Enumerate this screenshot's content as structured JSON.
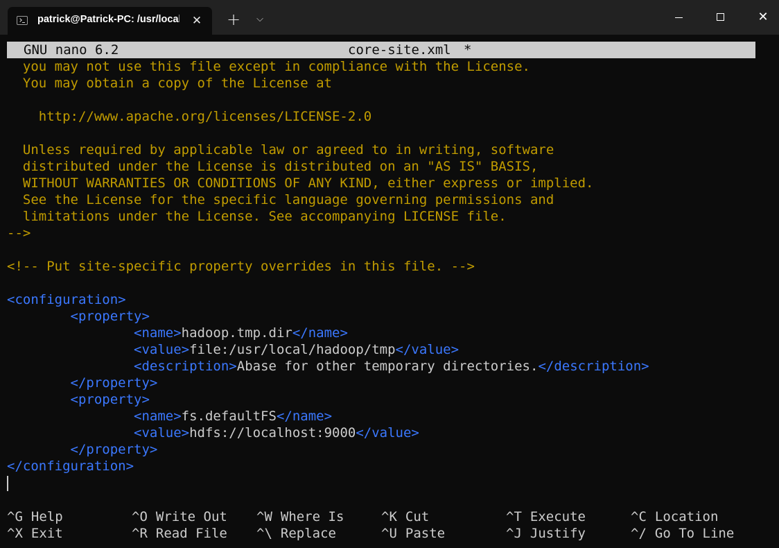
{
  "window": {
    "tab_title": "patrick@Patrick-PC: /usr/local/hadoop/etc/hadoop",
    "tab_close_glyph": "✕",
    "new_tab_glyph": "+",
    "dropdown_glyph": "⌵",
    "close_glyph": "✕"
  },
  "nano": {
    "version": "GNU nano 6.2",
    "filename": "core-site.xml",
    "modified_flag": "*"
  },
  "lines": [
    [
      {
        "t": "  you may not use this file except in compliance with the License.",
        "c": "cmt"
      }
    ],
    [
      {
        "t": "  You may obtain a copy of the License at",
        "c": "cmt"
      }
    ],
    [
      {
        "t": "",
        "c": "txt"
      }
    ],
    [
      {
        "t": "    http://www.apache.org/licenses/LICENSE-2.0",
        "c": "cmt"
      }
    ],
    [
      {
        "t": "",
        "c": "txt"
      }
    ],
    [
      {
        "t": "  Unless required by applicable law or agreed to in writing, software",
        "c": "cmt"
      }
    ],
    [
      {
        "t": "  distributed under the License is distributed on an \"AS IS\" BASIS,",
        "c": "cmt"
      }
    ],
    [
      {
        "t": "  WITHOUT WARRANTIES OR CONDITIONS OF ANY KIND, either express or implied.",
        "c": "cmt"
      }
    ],
    [
      {
        "t": "  See the License for the specific language governing permissions and",
        "c": "cmt"
      }
    ],
    [
      {
        "t": "  limitations under the License. See accompanying LICENSE file.",
        "c": "cmt"
      }
    ],
    [
      {
        "t": "-->",
        "c": "cmt"
      }
    ],
    [
      {
        "t": "",
        "c": "txt"
      }
    ],
    [
      {
        "t": "<!-- Put site-specific property overrides in this file. -->",
        "c": "cmt"
      }
    ],
    [
      {
        "t": "",
        "c": "txt"
      }
    ],
    [
      {
        "t": "<configuration>",
        "c": "tag"
      }
    ],
    [
      {
        "t": "        ",
        "c": "txt"
      },
      {
        "t": "<property>",
        "c": "tag"
      }
    ],
    [
      {
        "t": "                ",
        "c": "txt"
      },
      {
        "t": "<name>",
        "c": "tag"
      },
      {
        "t": "hadoop.tmp.dir",
        "c": "txt"
      },
      {
        "t": "</name>",
        "c": "tag"
      }
    ],
    [
      {
        "t": "                ",
        "c": "txt"
      },
      {
        "t": "<value>",
        "c": "tag"
      },
      {
        "t": "file:/usr/local/hadoop/tmp",
        "c": "txt"
      },
      {
        "t": "</value>",
        "c": "tag"
      }
    ],
    [
      {
        "t": "                ",
        "c": "txt"
      },
      {
        "t": "<description>",
        "c": "tag"
      },
      {
        "t": "Abase for other temporary directories.",
        "c": "txt"
      },
      {
        "t": "</description>",
        "c": "tag"
      }
    ],
    [
      {
        "t": "        ",
        "c": "txt"
      },
      {
        "t": "</property>",
        "c": "tag"
      }
    ],
    [
      {
        "t": "        ",
        "c": "txt"
      },
      {
        "t": "<property>",
        "c": "tag"
      }
    ],
    [
      {
        "t": "                ",
        "c": "txt"
      },
      {
        "t": "<name>",
        "c": "tag"
      },
      {
        "t": "fs.defaultFS",
        "c": "txt"
      },
      {
        "t": "</name>",
        "c": "tag"
      }
    ],
    [
      {
        "t": "                ",
        "c": "txt"
      },
      {
        "t": "<value>",
        "c": "tag"
      },
      {
        "t": "hdfs://localhost:9000",
        "c": "txt"
      },
      {
        "t": "</value>",
        "c": "tag"
      }
    ],
    [
      {
        "t": "        ",
        "c": "txt"
      },
      {
        "t": "</property>",
        "c": "tag"
      }
    ],
    [
      {
        "t": "</configuration>",
        "c": "tag"
      }
    ]
  ],
  "shortcuts": [
    {
      "key": "^G",
      "label": "Help"
    },
    {
      "key": "^X",
      "label": "Exit"
    },
    {
      "key": "^O",
      "label": "Write Out"
    },
    {
      "key": "^R",
      "label": "Read File"
    },
    {
      "key": "^W",
      "label": "Where Is"
    },
    {
      "key": "^\\",
      "label": "Replace"
    },
    {
      "key": "^K",
      "label": "Cut"
    },
    {
      "key": "^U",
      "label": "Paste"
    },
    {
      "key": "^T",
      "label": "Execute"
    },
    {
      "key": "^J",
      "label": "Justify"
    },
    {
      "key": "^C",
      "label": "Location"
    },
    {
      "key": "^/",
      "label": "Go To Line"
    }
  ],
  "colors": {
    "comment": "#c19c00",
    "tag": "#3b78ff",
    "text": "#cccccc",
    "background": "#0c0c0c",
    "titlebar": "#222222",
    "header_bar": "#cccccc"
  }
}
